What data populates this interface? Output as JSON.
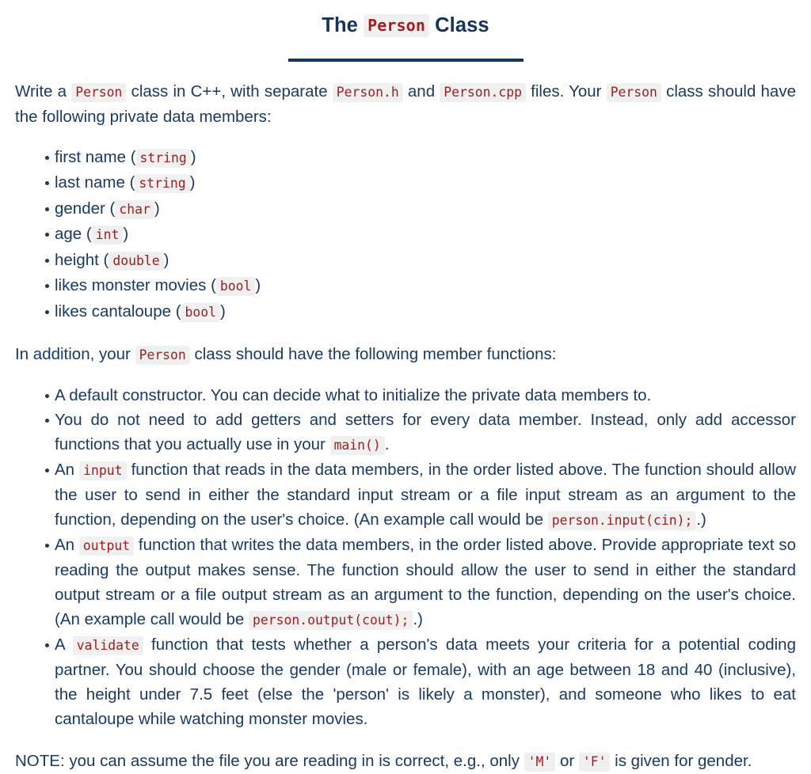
{
  "title": {
    "prefix": "The ",
    "code": "Person",
    "suffix": " Class"
  },
  "intro": {
    "seg1": "Write a ",
    "code1": "Person",
    "seg2": " class in C++, with separate ",
    "code2": "Person.h",
    "seg3": " and ",
    "code3": "Person.cpp",
    "seg4": " files. Your ",
    "code4": "Person",
    "seg5": " class should have the following private data members:"
  },
  "members": [
    {
      "label": "first name (",
      "type": "string",
      "close": ")"
    },
    {
      "label": "last name (",
      "type": "string",
      "close": ")"
    },
    {
      "label": "gender (",
      "type": "char",
      "close": ")"
    },
    {
      "label": "age (",
      "type": "int",
      "close": ")"
    },
    {
      "label": "height (",
      "type": "double",
      "close": ")"
    },
    {
      "label": "likes monster movies (",
      "type": "bool",
      "close": ")"
    },
    {
      "label": "likes cantaloupe (",
      "type": "bool",
      "close": ")"
    }
  ],
  "functions_intro": {
    "seg1": "In addition, your ",
    "code1": "Person",
    "seg2": " class should have the following member functions:"
  },
  "functions": {
    "constructor": "A default constructor. You can decide what to initialize the private data members to.",
    "getters": {
      "seg1": "You do not need to add getters and setters for every data member. Instead, only add accessor functions that you actually use in your ",
      "code1": "main()",
      "seg2": "."
    },
    "input": {
      "seg1": "An ",
      "code1": "input",
      "seg2": " function that reads in the data members, in the order listed above. The function should allow the user to send in either the standard input stream or a file input stream as an argument to the function, depending on the user's choice. (An example call would be ",
      "code2": "person.input(cin);",
      "seg3": ".)"
    },
    "output": {
      "seg1": "An ",
      "code1": "output",
      "seg2": " function that writes the data members, in the order listed above. Provide appropriate text so reading the output makes sense. The function should allow the user to send in either the standard output stream or a file output stream as an argument to the function, depending on the user's choice. (An example call would be ",
      "code2": "person.output(cout);",
      "seg3": ".)"
    },
    "validate": {
      "seg1": "A ",
      "code1": "validate",
      "seg2": " function that tests whether a person's data meets your criteria for a potential coding partner. You should choose the gender (male or female), with an age between 18 and 40 (inclusive), the height under 7.5 feet (else the 'person' is likely a monster), and someone who likes to eat cantaloupe while watching monster movies."
    }
  },
  "note": {
    "seg1": "NOTE: you can assume the file you are reading in is correct, e.g., only ",
    "code1": "'M'",
    "seg2": " or ",
    "code2": "'F'",
    "seg3": " is given for gender."
  },
  "colors": {
    "text": "#1b3a63",
    "title": "#16335e",
    "code_text": "#9d1f22",
    "code_bg": "#f0f0f0",
    "rule": "#16355f",
    "page_bg": "#ffffff"
  }
}
